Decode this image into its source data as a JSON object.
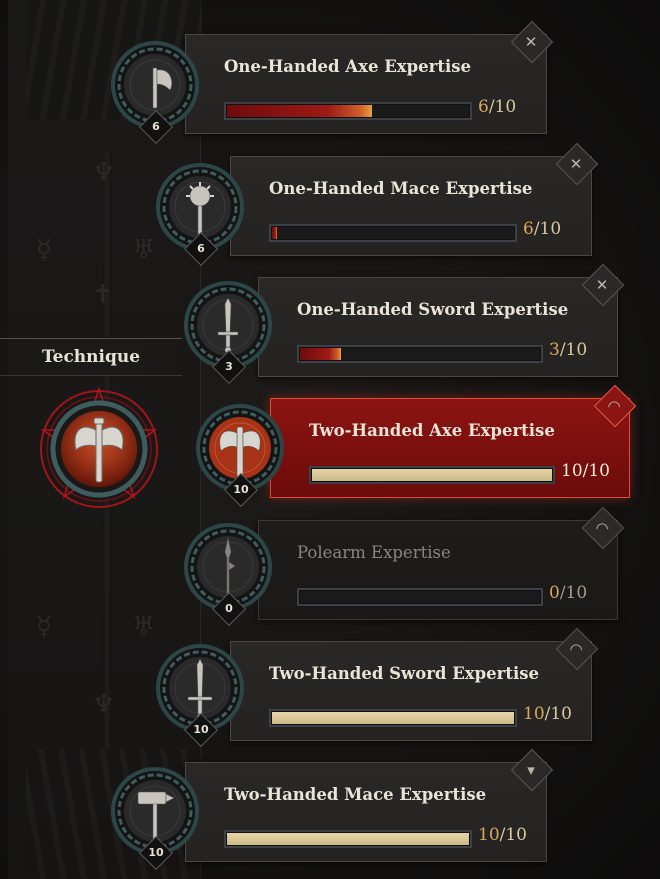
{
  "technique": {
    "label": "Technique",
    "icon": "double-axe-icon"
  },
  "skills": [
    {
      "name": "One-Handed Axe Expertise",
      "rank": "6",
      "current": "6",
      "max": "/10",
      "progress": 0.6,
      "icon": "axe-icon",
      "corner_icon": "axe-mace-corner-icon",
      "state": "normal",
      "fill": "red"
    },
    {
      "name": "One-Handed Mace Expertise",
      "rank": "6",
      "current": "6",
      "max": "/10",
      "progress": 0.02,
      "icon": "mace-icon",
      "corner_icon": "axe-mace-corner-icon",
      "state": "normal",
      "fill": "red"
    },
    {
      "name": "One-Handed Sword Expertise",
      "rank": "3",
      "current": "3",
      "max": "/10",
      "progress": 0.17,
      "icon": "sword-icon",
      "corner_icon": "axe-mace-corner-icon",
      "state": "normal",
      "fill": "red"
    },
    {
      "name": "Two-Handed Axe Expertise",
      "rank": "10",
      "current": "10",
      "max": "/10",
      "progress": 1.0,
      "icon": "double-axe-icon",
      "corner_icon": "signal-corner-icon",
      "state": "active",
      "fill": "gold"
    },
    {
      "name": "Polearm Expertise",
      "rank": "0",
      "current": "0",
      "max": "/10",
      "progress": 0.0,
      "icon": "polearm-icon",
      "corner_icon": "signal-corner-icon",
      "state": "dim",
      "fill": "gold"
    },
    {
      "name": "Two-Handed Sword Expertise",
      "rank": "10",
      "current": "10",
      "max": "/10",
      "progress": 1.0,
      "icon": "greatsword-icon",
      "corner_icon": "signal-corner-icon",
      "state": "normal",
      "fill": "gold"
    },
    {
      "name": "Two-Handed Mace Expertise",
      "rank": "10",
      "current": "10",
      "max": "/10",
      "progress": 1.0,
      "icon": "hammer-icon",
      "corner_icon": "funnel-corner-icon",
      "state": "normal",
      "fill": "gold"
    }
  ],
  "colors": {
    "active_card": "#8c1513",
    "red_fill": "#9e1a16",
    "gold_fill": "#e0cfa0",
    "count_accent": "#d9a85a",
    "ring": "#3f5c5e"
  }
}
